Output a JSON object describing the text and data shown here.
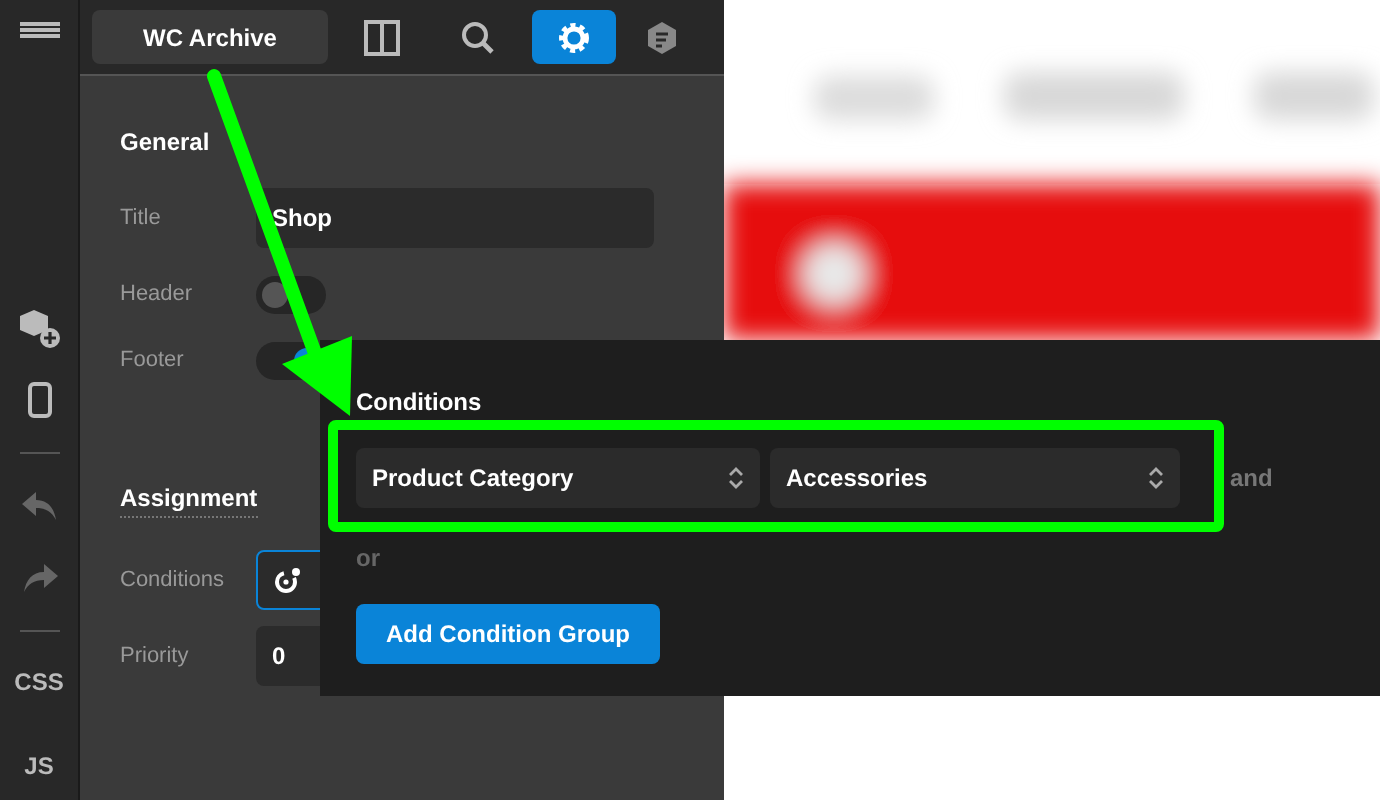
{
  "toolbar": {
    "template_name": "WC Archive",
    "tabs": [
      {
        "kind": "layout",
        "selected": false
      },
      {
        "kind": "search",
        "selected": false
      },
      {
        "kind": "settings",
        "selected": true
      },
      {
        "kind": "notes",
        "selected": false
      }
    ]
  },
  "rail": {
    "items": [
      {
        "kind": "add"
      },
      {
        "kind": "device"
      },
      {
        "kind": "undo"
      },
      {
        "kind": "redo"
      }
    ],
    "text_buttons": [
      "CSS",
      "JS"
    ]
  },
  "panel": {
    "general_heading": "General",
    "fields": [
      {
        "kind": "text",
        "label": "Title",
        "value": "Shop"
      },
      {
        "kind": "toggle",
        "label": "Header",
        "on": false
      },
      {
        "kind": "toggle",
        "label": "Footer",
        "on": true
      }
    ],
    "assignment_heading": "Assignment",
    "assignment_fields": [
      {
        "kind": "conditions",
        "label": "Conditions"
      },
      {
        "kind": "text",
        "label": "Priority",
        "value": "0"
      }
    ]
  },
  "conditions_popup": {
    "title": "Conditions",
    "selects": [
      "Product Category",
      "Accessories"
    ],
    "and_label": "and",
    "or_label": "or",
    "add_button": "Add Condition Group"
  }
}
